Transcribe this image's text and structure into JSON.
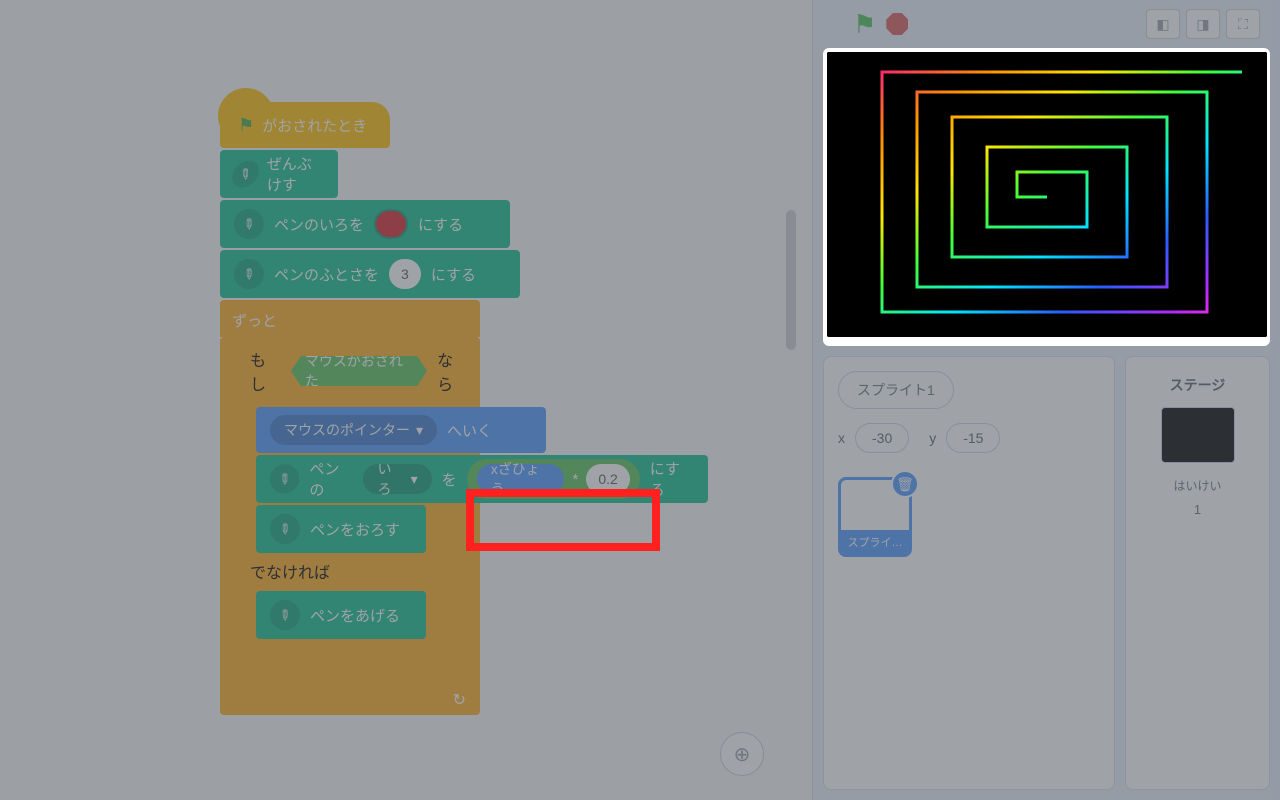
{
  "blocks": {
    "hat": "がおされたとき",
    "clear": "ぜんぶけす",
    "penColor_pre": "ペンのいろを",
    "penColor_post": "にする",
    "penSize_pre": "ペンのふとさを",
    "penSize_val": "3",
    "penSize_post": "にする",
    "forever": "ずっと",
    "if": "もし",
    "mouseDown": "マウスがおされた",
    "then": "なら",
    "goto": "マウスのポインター",
    "goto_post": "へいく",
    "penProp_pre": "ペンの",
    "penProp_sel": "いろ",
    "penProp_mid": "を",
    "xpos": "xざひょう",
    "mul": "*",
    "mul_val": "0.2",
    "penProp_post": "にする",
    "penDown": "ペンをおろす",
    "else": "でなければ",
    "penUp": "ペンをあげる",
    "loop_tail": "↻"
  },
  "stageControls": {
    "dropdown_caret": "▾"
  },
  "spritePanel": {
    "spriteName": "スプライト1",
    "xLabel": "x",
    "xVal": "-30",
    "yLabel": "y",
    "yVal": "-15",
    "thumbLabel": "スプライ…"
  },
  "stagePanel": {
    "title": "ステージ",
    "backdropLabel": "はいけい",
    "backdropCount": "1"
  }
}
